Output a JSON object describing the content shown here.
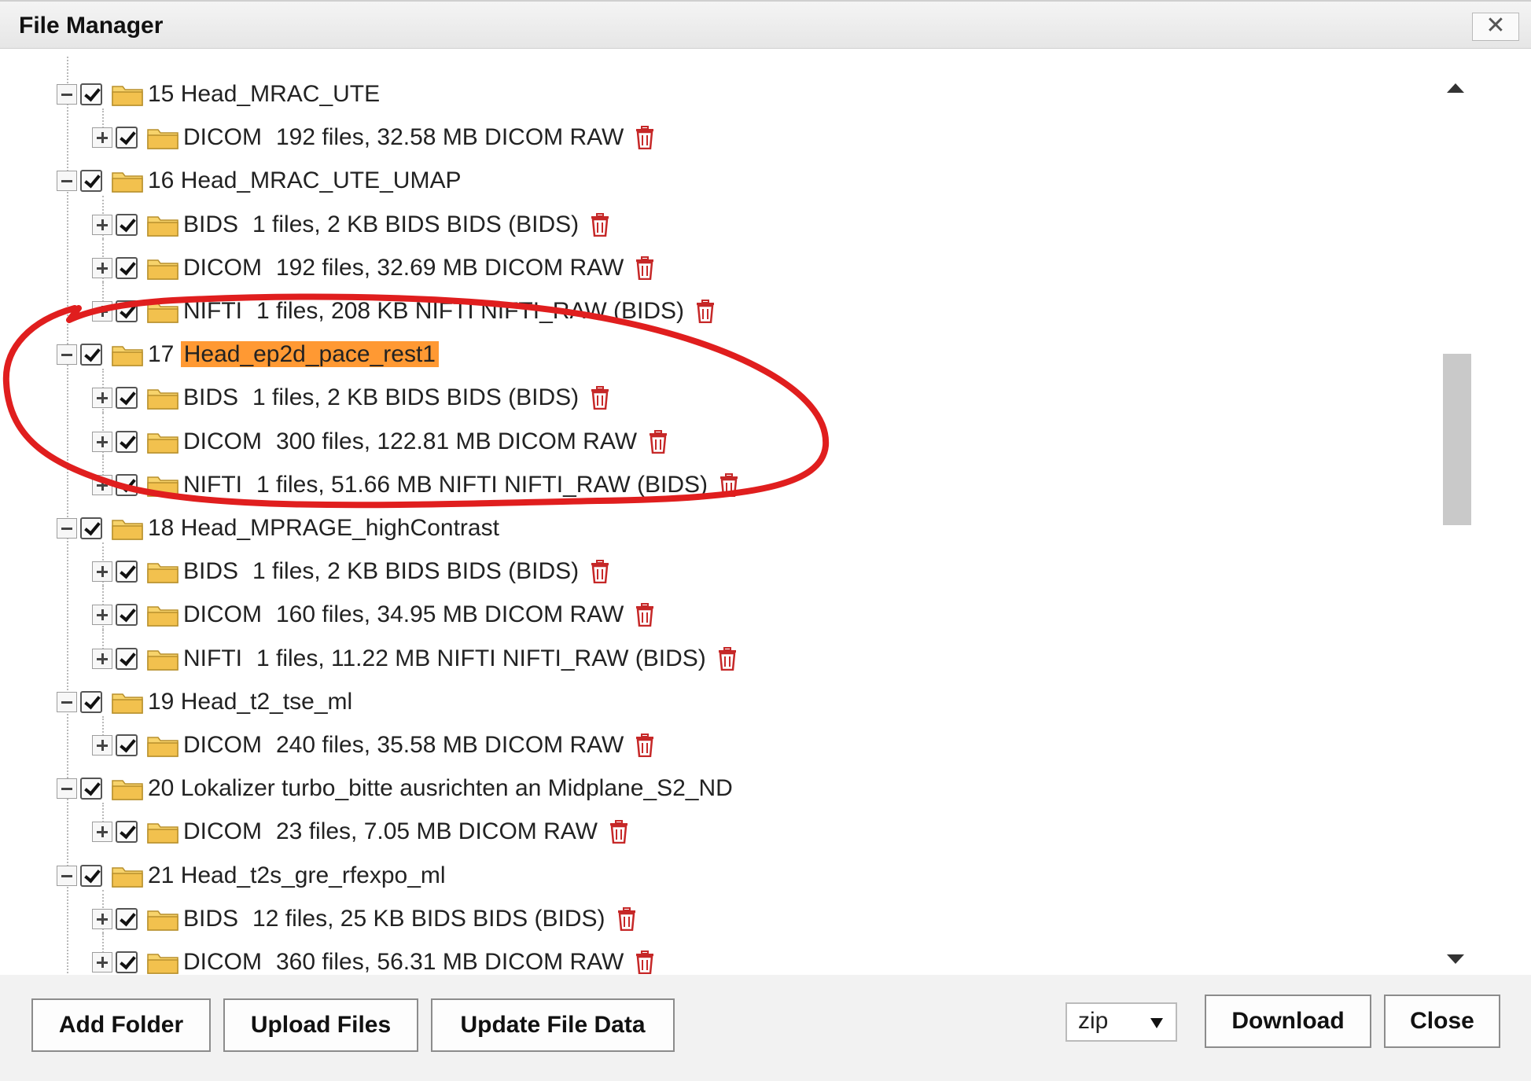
{
  "window": {
    "title": "File Manager",
    "close_glyph": "✕"
  },
  "icons": {
    "folder": "folder-icon",
    "delete": "trash-icon",
    "collapse": "minus-icon",
    "expand": "plus-icon",
    "checkbox": "checked-checkbox"
  },
  "colors": {
    "highlight": "#ff9933",
    "annotation": "#e01e1e",
    "trash": "#c62828",
    "folder": "#f2c14e"
  },
  "tree": [
    {
      "level": 0,
      "expanded": true,
      "label": "15 Head_MRAC_UTE"
    },
    {
      "level": 1,
      "expanded": false,
      "name": "DICOM",
      "info": "192 files, 32.58 MB DICOM RAW",
      "deletable": true
    },
    {
      "level": 0,
      "expanded": true,
      "label": "16 Head_MRAC_UTE_UMAP"
    },
    {
      "level": 1,
      "expanded": false,
      "name": "BIDS",
      "info": "1 files, 2 KB BIDS BIDS (BIDS)",
      "deletable": true
    },
    {
      "level": 1,
      "expanded": false,
      "name": "DICOM",
      "info": "192 files, 32.69 MB DICOM RAW",
      "deletable": true
    },
    {
      "level": 1,
      "expanded": false,
      "name": "NIFTI",
      "info": "1 files, 208 KB NIFTI NIFTI_RAW (BIDS)",
      "deletable": true
    },
    {
      "level": 0,
      "expanded": true,
      "label_prefix": "17",
      "label_highlight": "Head_ep2d_pace_rest1"
    },
    {
      "level": 1,
      "expanded": false,
      "name": "BIDS",
      "info": "1 files, 2 KB BIDS BIDS (BIDS)",
      "deletable": true
    },
    {
      "level": 1,
      "expanded": false,
      "name": "DICOM",
      "info": "300 files, 122.81 MB DICOM RAW",
      "deletable": true
    },
    {
      "level": 1,
      "expanded": false,
      "name": "NIFTI",
      "info": "1 files, 51.66 MB NIFTI NIFTI_RAW (BIDS)",
      "deletable": true
    },
    {
      "level": 0,
      "expanded": true,
      "label": "18 Head_MPRAGE_highContrast"
    },
    {
      "level": 1,
      "expanded": false,
      "name": "BIDS",
      "info": "1 files, 2 KB BIDS BIDS (BIDS)",
      "deletable": true
    },
    {
      "level": 1,
      "expanded": false,
      "name": "DICOM",
      "info": "160 files, 34.95 MB DICOM RAW",
      "deletable": true
    },
    {
      "level": 1,
      "expanded": false,
      "name": "NIFTI",
      "info": "1 files, 11.22 MB NIFTI NIFTI_RAW (BIDS)",
      "deletable": true
    },
    {
      "level": 0,
      "expanded": true,
      "label": "19 Head_t2_tse_ml"
    },
    {
      "level": 1,
      "expanded": false,
      "name": "DICOM",
      "info": "240 files, 35.58 MB DICOM RAW",
      "deletable": true
    },
    {
      "level": 0,
      "expanded": true,
      "label": "20 Lokalizer turbo_bitte ausrichten an Midplane_S2_ND"
    },
    {
      "level": 1,
      "expanded": false,
      "name": "DICOM",
      "info": "23 files, 7.05 MB DICOM RAW",
      "deletable": true
    },
    {
      "level": 0,
      "expanded": true,
      "label": "21 Head_t2s_gre_rfexpo_ml"
    },
    {
      "level": 1,
      "expanded": false,
      "name": "BIDS",
      "info": "12 files, 25 KB BIDS BIDS (BIDS)",
      "deletable": true
    },
    {
      "level": 1,
      "expanded": false,
      "name": "DICOM",
      "info": "360 files, 56.31 MB DICOM RAW",
      "deletable": true
    }
  ],
  "footer": {
    "add_folder": "Add Folder",
    "upload_files": "Upload Files",
    "update_file_data": "Update File Data",
    "format_selected": "zip",
    "download": "Download",
    "close": "Close"
  }
}
